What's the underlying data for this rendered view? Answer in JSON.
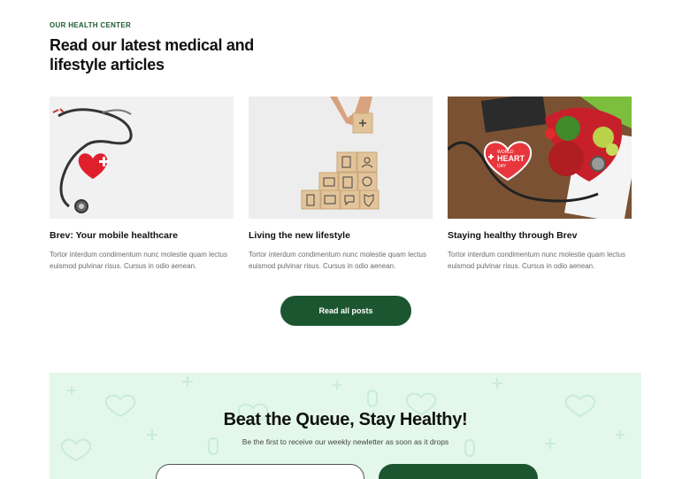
{
  "section": {
    "eyebrow": "OUR HEALTH CENTER",
    "headline": "Read our latest medical and lifestyle articles"
  },
  "articles": [
    {
      "title": "Brev: Your mobile healthcare",
      "excerpt": "Tortor interdum condimentum nunc molestie quam lectus euismod pulvinar risus. Cursus in odio aenean.",
      "image": "stethoscope-heart-image"
    },
    {
      "title": "Living the new lifestyle",
      "excerpt": "Tortor interdum condimentum nunc molestie quam lectus euismod pulvinar risus. Cursus in odio aenean.",
      "image": "health-icon-blocks-image"
    },
    {
      "title": "Staying healthy through Brev",
      "excerpt": "Tortor interdum condimentum nunc molestie quam lectus euismod pulvinar risus. Cursus in odio aenean.",
      "image": "world-heart-day-image",
      "image_text": [
        "WORLD",
        "HEART",
        "DAY"
      ]
    }
  ],
  "cta": {
    "label": "Read all posts"
  },
  "newsletter": {
    "title": "Beat the Queue, Stay Healthy!",
    "subtitle": "Be the first to receive our weekly newletter as soon as it drops"
  },
  "colors": {
    "brand_green": "#1b5631",
    "eyebrow_green": "#1e5a32",
    "newsletter_bg": "#e3f8ea"
  }
}
